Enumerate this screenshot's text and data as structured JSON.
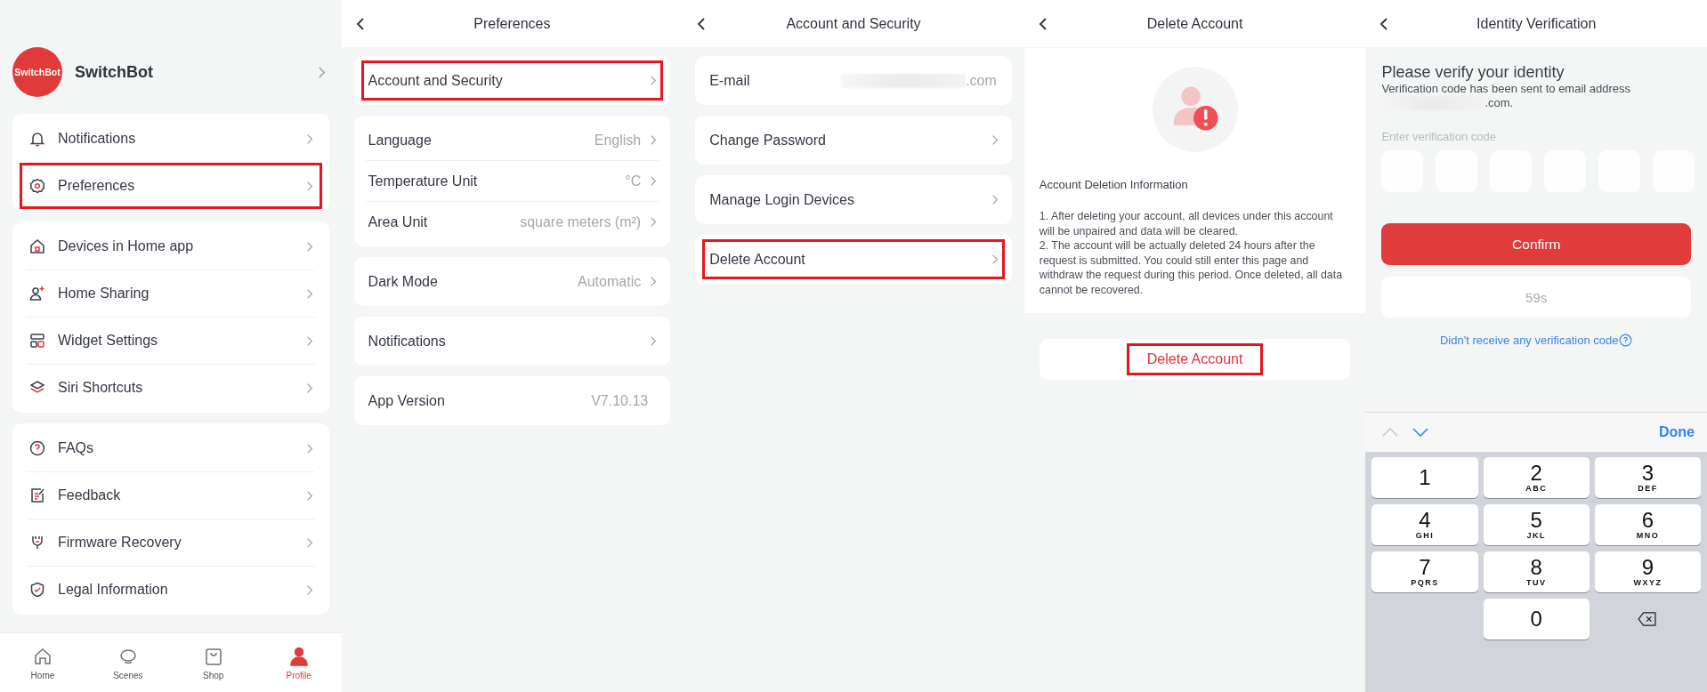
{
  "profile_screen": {
    "avatar_text": "SwitchBot",
    "name": "SwitchBot",
    "groups": [
      {
        "rows": [
          {
            "label": "Notifications",
            "highlighted": false
          },
          {
            "label": "Preferences",
            "highlighted": true
          }
        ]
      },
      {
        "rows": [
          {
            "label": "Devices in Home app",
            "highlighted": false
          },
          {
            "label": "Home Sharing",
            "highlighted": false
          },
          {
            "label": "Widget Settings",
            "highlighted": false
          },
          {
            "label": "Siri Shortcuts",
            "highlighted": false
          }
        ]
      },
      {
        "rows": [
          {
            "label": "FAQs",
            "highlighted": false
          },
          {
            "label": "Feedback",
            "highlighted": false
          },
          {
            "label": "Firmware Recovery",
            "highlighted": false
          },
          {
            "label": "Legal Information",
            "highlighted": false
          }
        ]
      }
    ],
    "tab_bar": [
      {
        "label": "Home",
        "selected": false
      },
      {
        "label": "Scenes",
        "selected": false
      },
      {
        "label": "Shop",
        "selected": false
      },
      {
        "label": "Profile",
        "selected": true
      }
    ]
  },
  "preferences_screen": {
    "title": "Preferences",
    "groups": [
      {
        "rows": [
          {
            "label": "Account and Security",
            "chevron": true,
            "highlighted": true
          }
        ]
      },
      {
        "rows": [
          {
            "label": "Language",
            "value": "English",
            "chevron": true,
            "highlighted": false
          },
          {
            "label": "Temperature Unit",
            "value": "°C",
            "chevron": true,
            "highlighted": false
          },
          {
            "label": "Area Unit",
            "value": "square meters (m²)",
            "chevron": true,
            "highlighted": false
          }
        ]
      },
      {
        "rows": [
          {
            "label": "Dark Mode",
            "value": "Automatic",
            "chevron": true,
            "highlighted": false
          }
        ]
      },
      {
        "rows": [
          {
            "label": "Notifications",
            "chevron": true,
            "highlighted": false
          }
        ]
      },
      {
        "rows": [
          {
            "label": "App Version",
            "value": "V7.10.13",
            "chevron": false,
            "highlighted": false
          }
        ]
      }
    ]
  },
  "account_security_screen": {
    "title": "Account and Security",
    "groups": [
      {
        "rows": [
          {
            "label": "E-mail",
            "value": ".com",
            "redacted": true,
            "chevron": false,
            "highlighted": false
          }
        ]
      },
      {
        "rows": [
          {
            "label": "Change Password",
            "redacted": false,
            "chevron": true,
            "highlighted": false
          }
        ]
      },
      {
        "rows": [
          {
            "label": "Manage Login Devices",
            "redacted": false,
            "chevron": true,
            "highlighted": false
          }
        ]
      },
      {
        "rows": [
          {
            "label": "Delete Account",
            "redacted": false,
            "chevron": true,
            "highlighted": true
          }
        ]
      }
    ]
  },
  "delete_account_screen": {
    "title": "Delete Account",
    "info_heading": "Account Deletion Information",
    "info_items": [
      "1. After deleting your account, all devices under this account will be unpaired and data will be cleared.",
      "2. The account will be actually deleted 24 hours after the request is submitted. You could still enter this page and withdraw the request during this period. Once deleted, all data cannot be recovered."
    ],
    "button": {
      "label": "Delete Account",
      "highlighted": true
    }
  },
  "identity_screen": {
    "title": "Identity Verification",
    "heading": "Please verify your identity",
    "message": "Verification code has been sent to email address",
    "email_visible": ".com.",
    "code_label": "Enter verification code",
    "confirm_button": "Confirm",
    "resend_button": {
      "label": "59s",
      "disabled": true
    },
    "help_link": "Didn't receive any verification code",
    "keyboard": {
      "up_enabled": false,
      "down_enabled": true,
      "done": "Done",
      "keys": [
        {
          "kind": "digit",
          "digit": "1"
        },
        {
          "kind": "digit",
          "digit": "2",
          "letters": "ABC"
        },
        {
          "kind": "digit",
          "digit": "3",
          "letters": "DEF"
        },
        {
          "kind": "digit",
          "digit": "4",
          "letters": "GHI"
        },
        {
          "kind": "digit",
          "digit": "5",
          "letters": "JKL"
        },
        {
          "kind": "digit",
          "digit": "6",
          "letters": "MNO"
        },
        {
          "kind": "digit",
          "digit": "7",
          "letters": "PQRS"
        },
        {
          "kind": "digit",
          "digit": "8",
          "letters": "TUV"
        },
        {
          "kind": "digit",
          "digit": "9",
          "letters": "WXYZ"
        },
        {
          "kind": "blank"
        },
        {
          "kind": "digit",
          "digit": "0"
        },
        {
          "kind": "delete"
        }
      ]
    }
  }
}
